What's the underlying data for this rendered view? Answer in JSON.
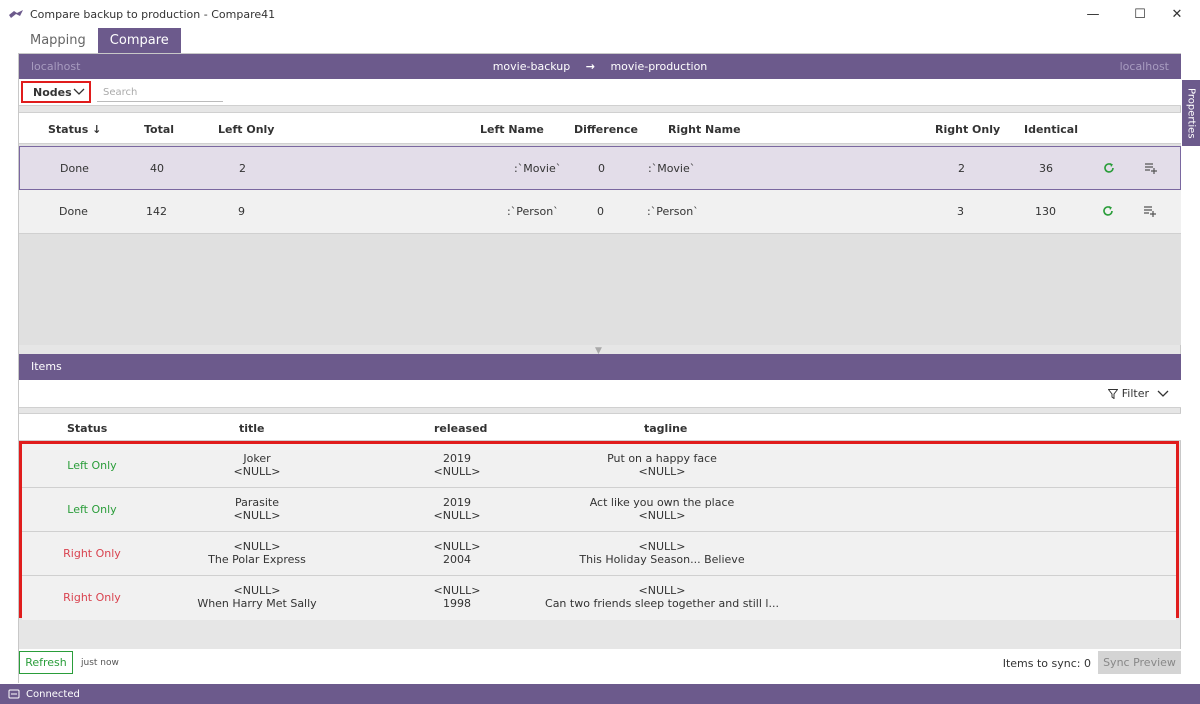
{
  "window": {
    "title": "Compare backup to production - Compare41",
    "minimize": "—",
    "maximize": "☐",
    "close": "✕"
  },
  "tabs": [
    {
      "label": "Mapping"
    },
    {
      "label": "Compare"
    }
  ],
  "header": {
    "left_host": "localhost",
    "right_host": "localhost",
    "left_db": "movie-backup",
    "arrow": "→",
    "right_db": "movie-production"
  },
  "properties_tab": "Properties",
  "toolbar": {
    "dropdown_value": "Nodes",
    "search_placeholder": "Search"
  },
  "summary": {
    "columns": {
      "status": "Status ↓",
      "total": "Total",
      "left_only": "Left Only",
      "left_name": "Left Name",
      "difference": "Difference",
      "right_name": "Right Name",
      "right_only": "Right Only",
      "identical": "Identical"
    },
    "rows": [
      {
        "status": "Done",
        "total": "40",
        "left_only": "2",
        "left_name": ":`Movie`",
        "difference": "0",
        "right_name": ":`Movie`",
        "right_only": "2",
        "identical": "36"
      },
      {
        "status": "Done",
        "total": "142",
        "left_only": "9",
        "left_name": ":`Person`",
        "difference": "0",
        "right_name": ":`Person`",
        "right_only": "3",
        "identical": "130"
      }
    ]
  },
  "items": {
    "title": "Items",
    "filter_label": "Filter",
    "columns": {
      "status": "Status",
      "title": "title",
      "released": "released",
      "tagline": "tagline"
    },
    "rows": [
      {
        "status": "Left Only",
        "title_l": "Joker",
        "title_r": "<NULL>",
        "released_l": "2019",
        "released_r": "<NULL>",
        "tagline_l": "Put on a happy face",
        "tagline_r": "<NULL>"
      },
      {
        "status": "Left Only",
        "title_l": "Parasite",
        "title_r": "<NULL>",
        "released_l": "2019",
        "released_r": "<NULL>",
        "tagline_l": "Act like you own the place",
        "tagline_r": "<NULL>"
      },
      {
        "status": "Right Only",
        "title_l": "<NULL>",
        "title_r": "The Polar Express",
        "released_l": "<NULL>",
        "released_r": "2004",
        "tagline_l": "<NULL>",
        "tagline_r": "This Holiday Season... Believe"
      },
      {
        "status": "Right Only",
        "title_l": "<NULL>",
        "title_r": "When Harry Met Sally",
        "released_l": "<NULL>",
        "released_r": "1998",
        "tagline_l": "<NULL>",
        "tagline_r": "Can two friends sleep together and still l..."
      }
    ]
  },
  "footer": {
    "refresh_label": "Refresh",
    "last_refresh": "just now",
    "items_to_sync": "Items to sync: 0",
    "sync_preview": "Sync Preview"
  },
  "statusbar": {
    "status": "Connected"
  },
  "colors": {
    "brand": "#6c5a8c",
    "left_only": "#2a9d3a",
    "right_only": "#d9434f",
    "highlight": "#e01c1c"
  }
}
